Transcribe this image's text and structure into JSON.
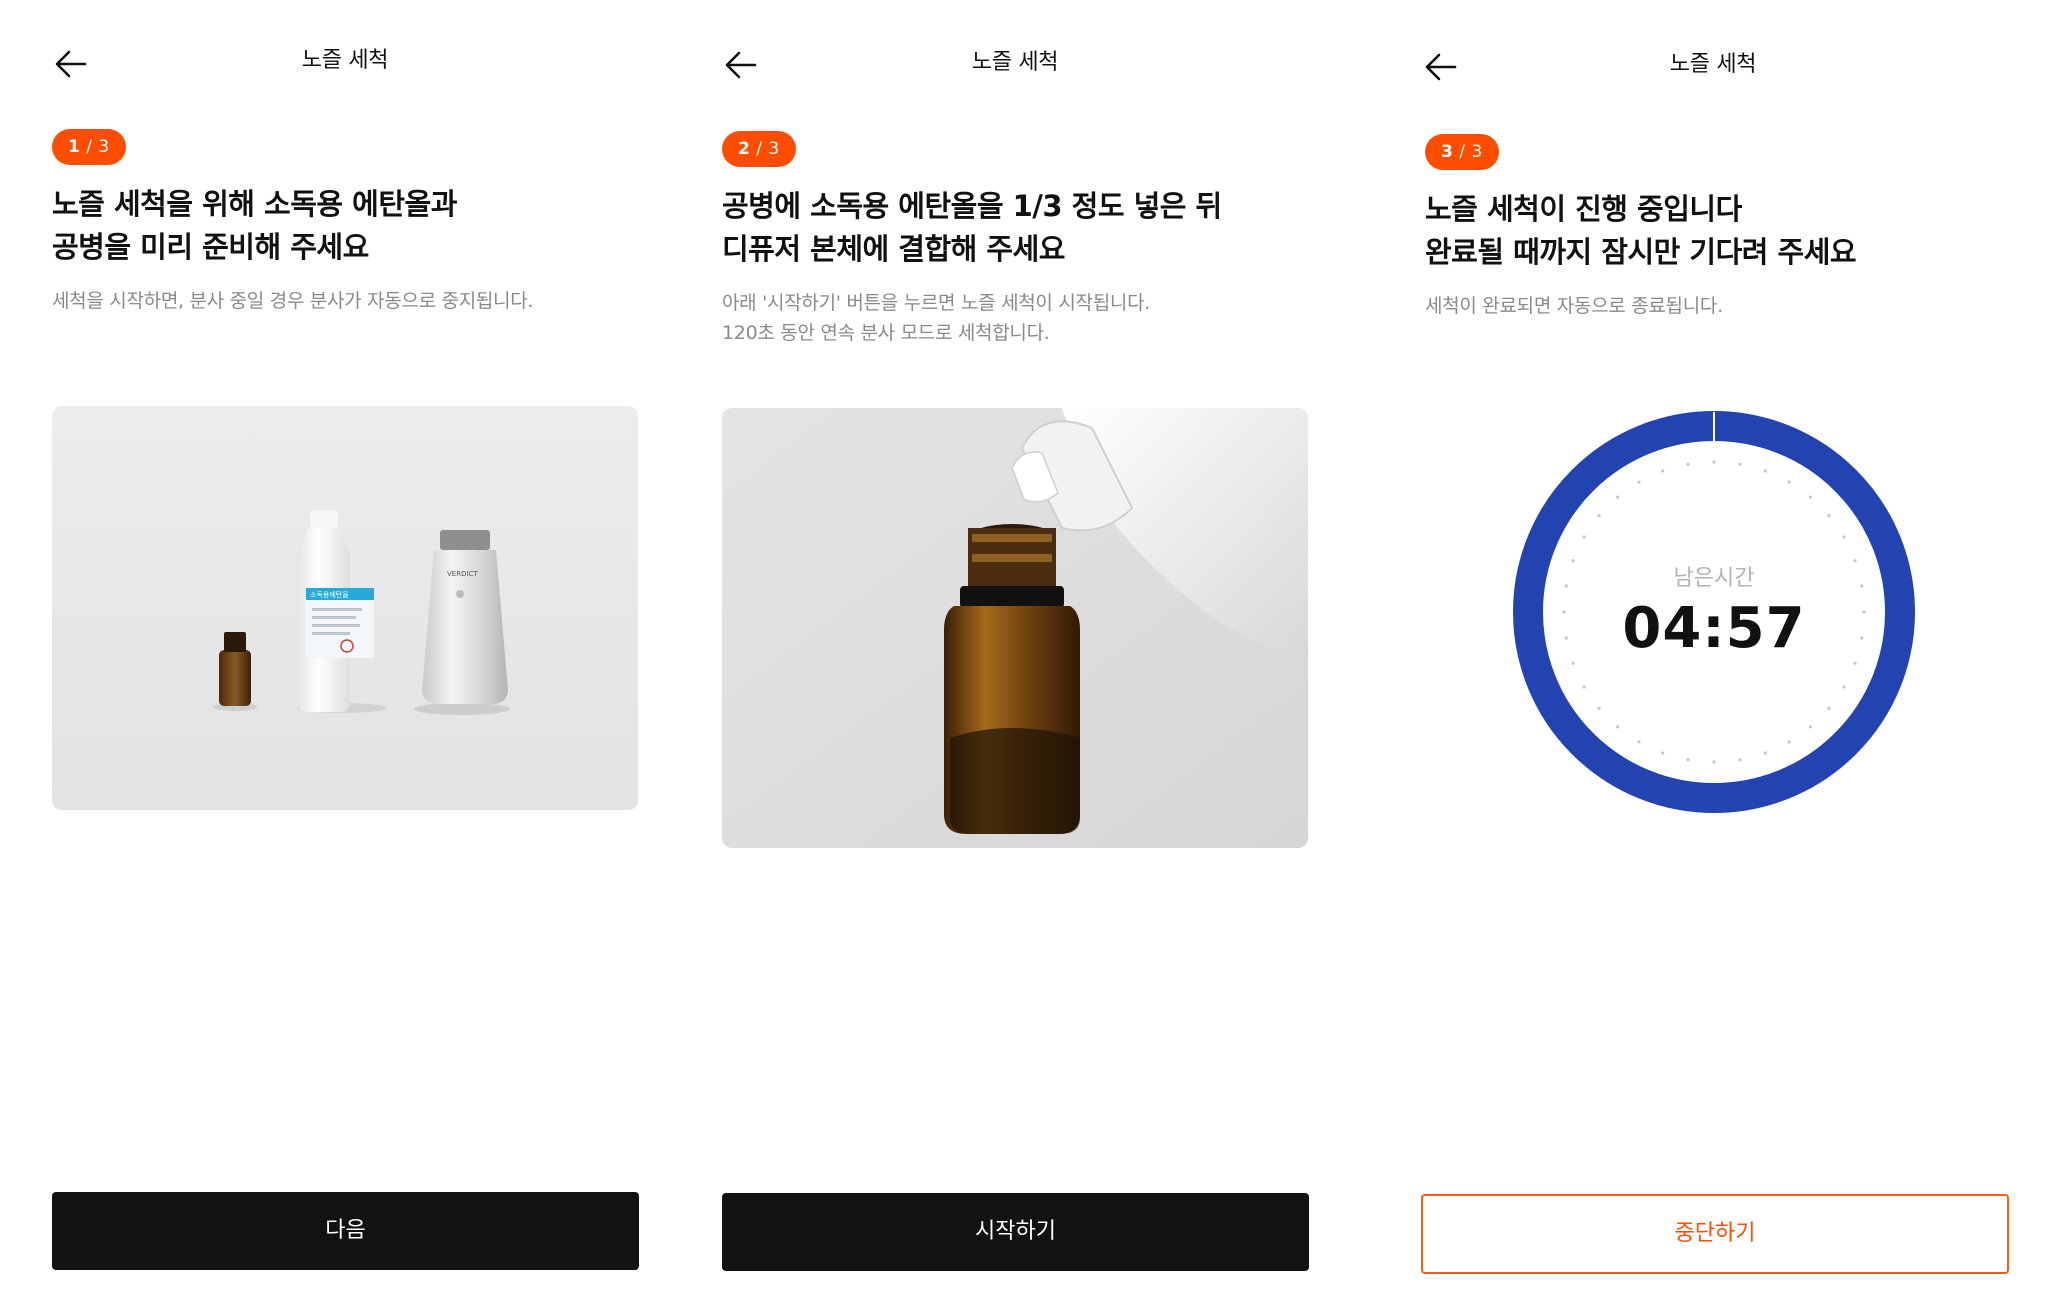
{
  "screens": [
    {
      "header_title": "노즐 세척",
      "step": {
        "current": "1",
        "separator": "/",
        "total": "3"
      },
      "headline_line1": "노즐 세척을 위해 소독용 에탄올과",
      "headline_line2": "공병을 미리 준비해 주세요",
      "description_line1": "세척을 시작하면, 분사 중일 경우 분사가 자동으로 중지됩니다.",
      "button_label": "다음"
    },
    {
      "header_title": "노즐 세척",
      "step": {
        "current": "2",
        "separator": "/",
        "total": "3"
      },
      "headline_line1": "공병에 소독용 에탄올을 1/3 정도 넣은 뒤",
      "headline_line2": "디퓨저 본체에 결합해 주세요",
      "description_line1": "아래 '시작하기' 버튼을 누르면 노즐 세척이 시작됩니다.",
      "description_line2": "120초 동안 연속 분사 모드로 세척합니다.",
      "button_label": "시작하기"
    },
    {
      "header_title": "노즐 세척",
      "step": {
        "current": "3",
        "separator": "/",
        "total": "3"
      },
      "headline_line1": "노즐 세척이 진행 중입니다",
      "headline_line2": "완료될 때까지 잠시만 기다려 주세요",
      "description_line1": "세척이 완료되면 자동으로 종료됩니다.",
      "timer_label": "남은시간",
      "timer_value": "04:57",
      "button_label": "중단하기"
    }
  ],
  "product_image_label": "VERDICT",
  "bottle_label_text": "소독용에탄올",
  "colors": {
    "accent_orange": "#ff4d00",
    "timer_ring_blue": "#2344b0",
    "primary_button": "#121212"
  }
}
